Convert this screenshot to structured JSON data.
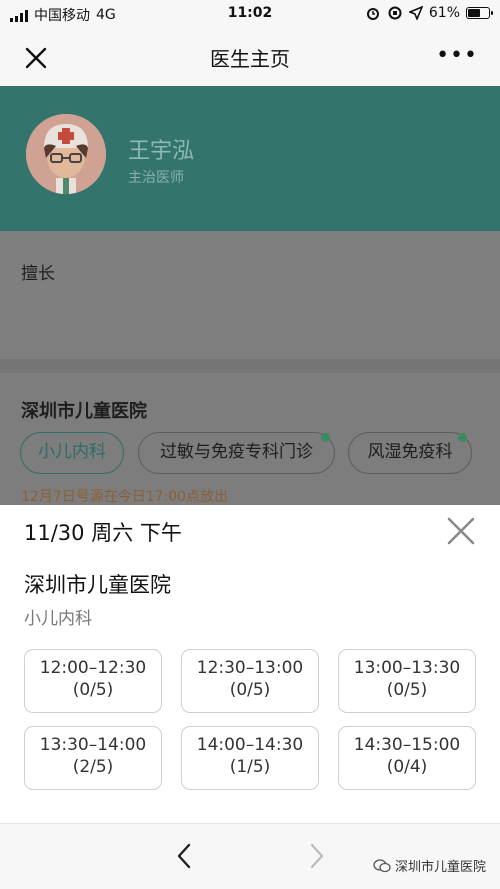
{
  "status_bar": {
    "carrier": "中国移动",
    "network": "4G",
    "time": "11:02",
    "battery": "61%",
    "battery_level": 0.61
  },
  "nav": {
    "title": "医生主页",
    "more": "•••"
  },
  "doctor": {
    "name": "王宇泓",
    "title": "主治医师"
  },
  "section_label": "擅长",
  "hospital_name": "深圳市儿童医院",
  "departments": [
    {
      "label": "小儿内科"
    },
    {
      "label": "过敏与免疫专科门诊"
    },
    {
      "label": "风湿免疫科"
    }
  ],
  "notice": "12月7日号源在今日17:00点放出",
  "sheet": {
    "date": "11/30 周六 下午",
    "hospital": "深圳市儿童医院",
    "department": "小儿内科",
    "slots": [
      {
        "time": "12:00–12:30",
        "count": "(0/5)"
      },
      {
        "time": "12:30–13:00",
        "count": "(0/5)"
      },
      {
        "time": "13:00–13:30",
        "count": "(0/5)"
      },
      {
        "time": "13:30–14:00",
        "count": "(2/5)"
      },
      {
        "time": "14:00–14:30",
        "count": "(1/5)"
      },
      {
        "time": "14:30–15:00",
        "count": "(0/4)"
      }
    ]
  },
  "watermark": "深圳市儿童医院",
  "colors": {
    "header_teal": "#33756d",
    "active_chip": "#2e6d64",
    "notice": "#8a6038"
  }
}
